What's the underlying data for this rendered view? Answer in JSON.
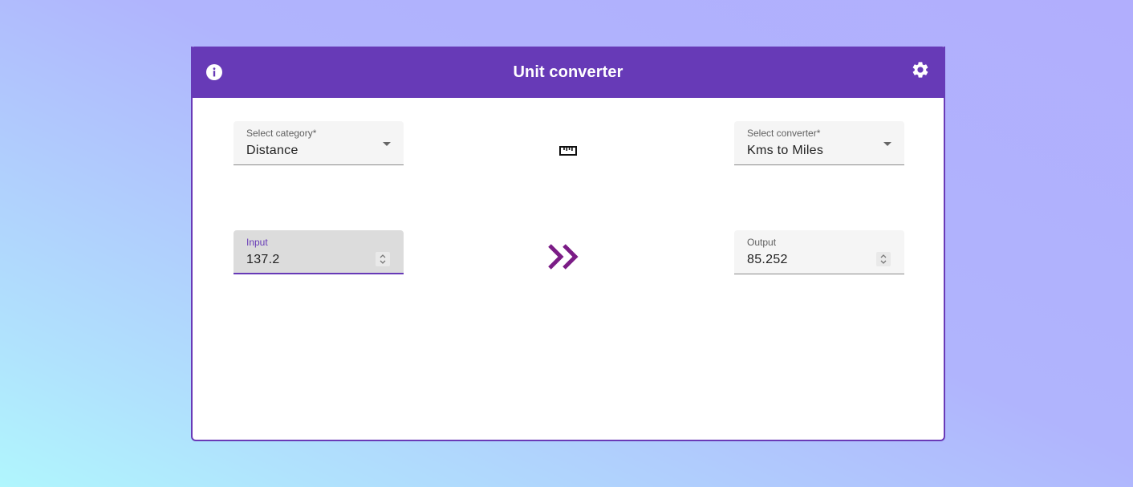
{
  "app": {
    "title": "Unit converter"
  },
  "header": {
    "info_icon": "info-icon",
    "settings_icon": "gear-icon"
  },
  "category": {
    "label": "Select category*",
    "value": "Distance"
  },
  "converter": {
    "label": "Select converter*",
    "value": "Kms to Miles"
  },
  "input": {
    "label": "Input",
    "value": "137.2"
  },
  "output": {
    "label": "Output",
    "value": "85.252"
  },
  "icons": {
    "category_icon": "ruler-icon",
    "convert_icon": "double-chevron-right-icon"
  },
  "colors": {
    "primary": "#673ab7",
    "accent": "#7b1fa2"
  }
}
